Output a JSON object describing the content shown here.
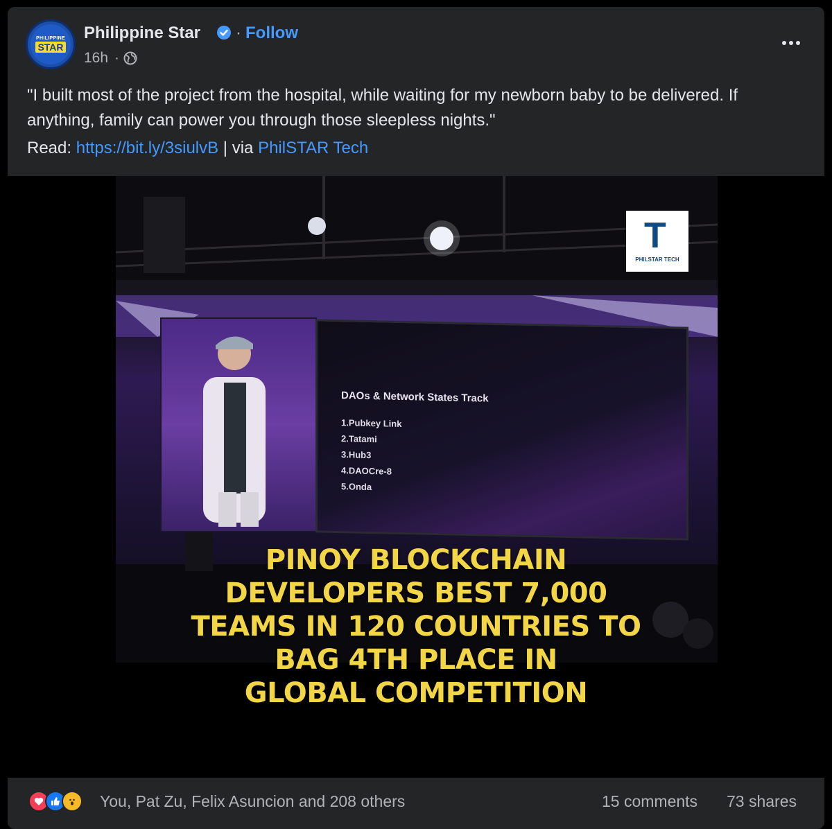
{
  "page": {
    "avatar_top_text": "PHILIPPINE",
    "avatar_brand": "STAR",
    "name": "Philippine Star",
    "follow_label": "Follow",
    "dot": "·",
    "time": "16h",
    "time_sep": "·",
    "verified": true,
    "privacy_icon": "globe-icon"
  },
  "post": {
    "text": "\"I built most of the project from the hospital, while waiting for my newborn baby to be delivered. If anything, family can power you through those sleepless nights.\"",
    "read_label": "Read: ",
    "read_link": "https://bit.ly/3siulvB",
    "via_sep": " | via ",
    "via_link": "PhilSTAR Tech"
  },
  "image": {
    "logo_letter": "T",
    "logo_label": "PHILSTAR TECH",
    "screen_title": "DAOs & Network States Track",
    "screen_items": [
      "1.Pubkey Link",
      "2.Tatami",
      "3.Hub3",
      "4.DAOCre-8",
      "5.Onda"
    ],
    "headline_lines": [
      "PINOY BLOCKCHAIN",
      "DEVELOPERS BEST 7,000",
      "TEAMS IN 120 COUNTRIES TO",
      "BAG 4TH PLACE IN",
      "GLOBAL COMPETITION"
    ]
  },
  "footer": {
    "reaction_icons": [
      "love-icon",
      "like-icon",
      "wow-icon"
    ],
    "reactors": "You, Pat Zu, Felix Asuncion and 208 others",
    "comments": "15 comments",
    "shares": "73 shares"
  },
  "colors": {
    "card_bg": "#242526",
    "link": "#4599ff",
    "headline": "#f3d646",
    "love": "#f33e58",
    "like": "#1877f2",
    "wow": "#f7b928"
  }
}
